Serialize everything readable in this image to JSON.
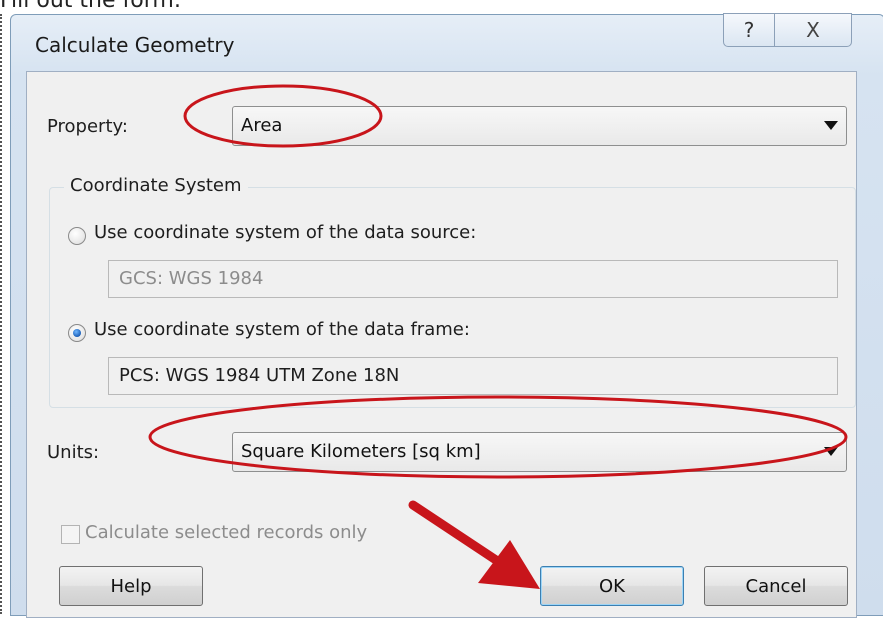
{
  "caption": "Fill out the form:",
  "window": {
    "title": "Calculate Geometry",
    "help_button": "?",
    "close_button": "X"
  },
  "property": {
    "label": "Property:",
    "value": "Area"
  },
  "coordinate_system": {
    "legend": "Coordinate System",
    "source_option": {
      "label": "Use coordinate system of the data source:",
      "value": "GCS: WGS 1984",
      "selected": false
    },
    "frame_option": {
      "label": "Use coordinate system of the data frame:",
      "value": "PCS: WGS 1984 UTM Zone 18N",
      "selected": true
    }
  },
  "units": {
    "label": "Units:",
    "value": "Square Kilometers [sq km]"
  },
  "selected_records": {
    "label": "Calculate selected records only",
    "checked": false,
    "enabled": false
  },
  "buttons": {
    "help": "Help",
    "ok": "OK",
    "cancel": "Cancel"
  },
  "colors": {
    "annotation": "#c8151b",
    "radio_selected": "#1b5fb8"
  },
  "icons": {
    "help": "question-mark-icon",
    "close": "close-x-icon",
    "dropdown": "chevron-down-icon"
  }
}
